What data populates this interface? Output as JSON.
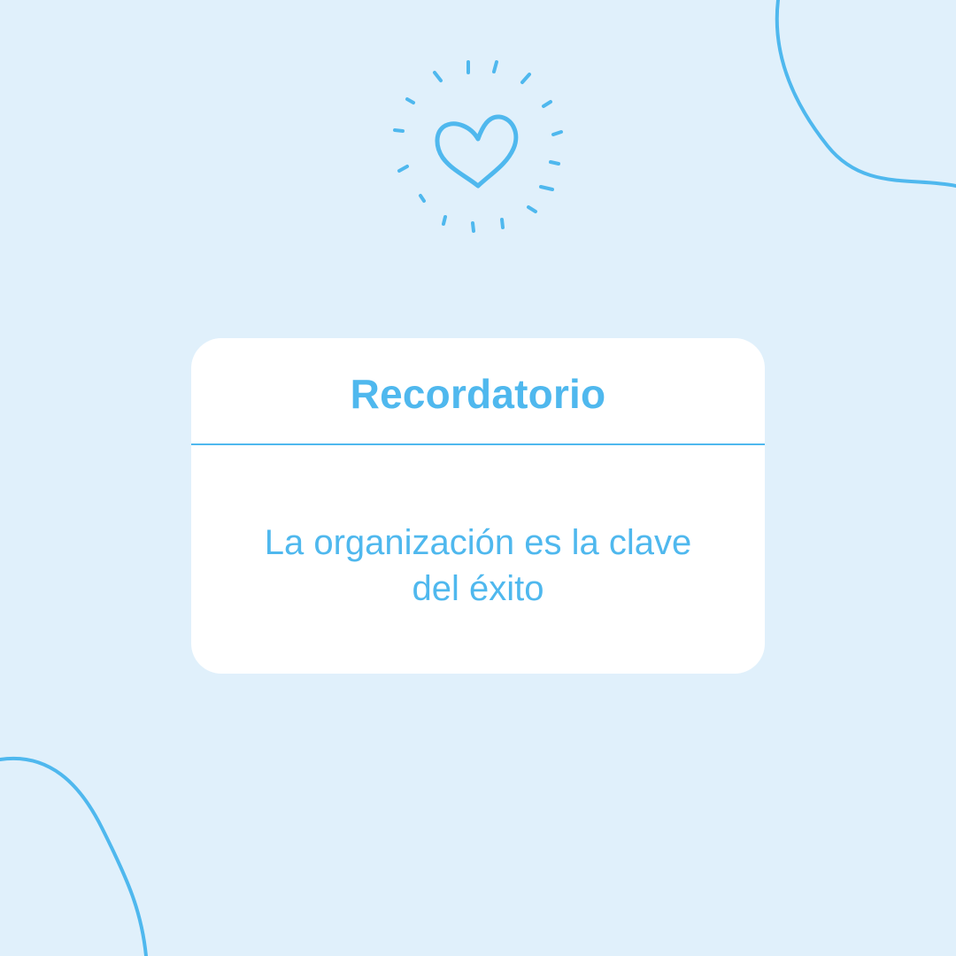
{
  "colors": {
    "background": "#e0f0fb",
    "accent": "#4fb8ee",
    "card": "#ffffff"
  },
  "card": {
    "title": "Recordatorio",
    "message": "La organización es la clave del éxito"
  },
  "icons": {
    "top": "heart-icon",
    "rays": "sparkle-rays-icon"
  }
}
